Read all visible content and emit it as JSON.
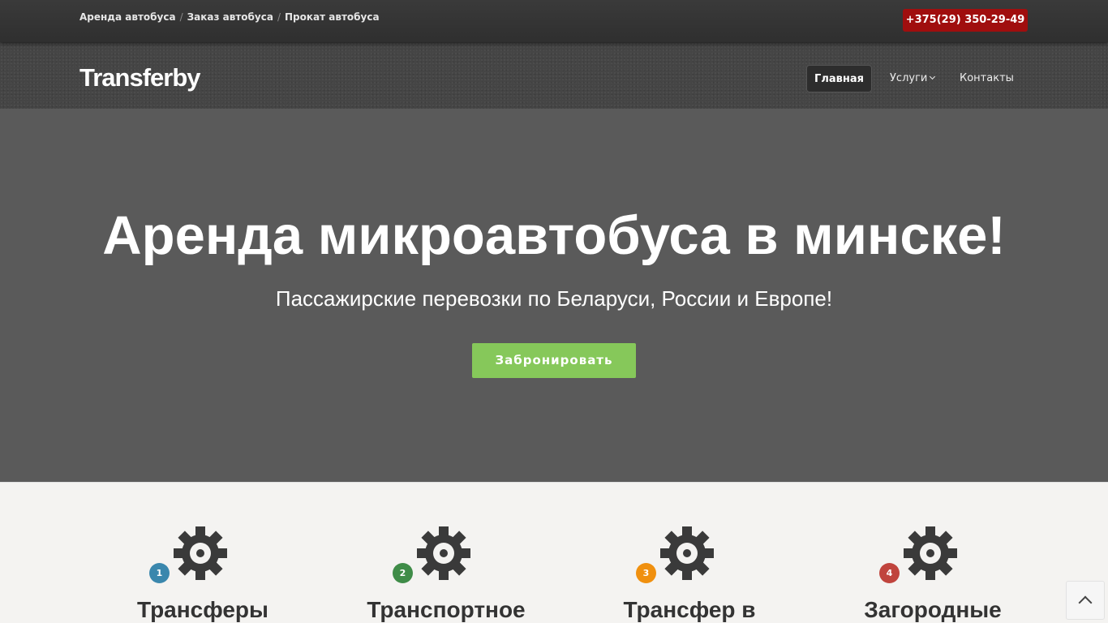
{
  "topbar": {
    "breadcrumbs": [
      "Аренда автобуса",
      "Заказ автобуса",
      "Прокат автобуса"
    ],
    "separator": "/",
    "phone": "+375(29) 350-29-49"
  },
  "header": {
    "logo": "Transferby",
    "nav": [
      {
        "label": "Главная",
        "active": true
      },
      {
        "label": "Услуги",
        "icon": "chevron-down-icon"
      },
      {
        "label": "Контакты"
      }
    ]
  },
  "hero": {
    "title": "Аренда микроавтобуса в минске!",
    "subtitle": "Пассажирские перевозки по Беларуси, России и Европе!",
    "button": "Забронировать"
  },
  "features": [
    {
      "number": "1",
      "title": "Трансферы",
      "color": "#3a87ad",
      "icon": "gear-icon"
    },
    {
      "number": "2",
      "title": "Транспортное",
      "color": "#3f8c48",
      "icon": "gear-icon"
    },
    {
      "number": "3",
      "title": "Трансфер в",
      "color": "#f0900f",
      "icon": "gear-icon"
    },
    {
      "number": "4",
      "title": "Загородные",
      "color": "#c0443d",
      "icon": "gear-icon"
    }
  ],
  "colors": {
    "phone_button": "#a00e0e",
    "book_button": "#86c85a",
    "hero_background": "#5a5a5a"
  },
  "scroll_top_icon": "chevron-up-icon"
}
